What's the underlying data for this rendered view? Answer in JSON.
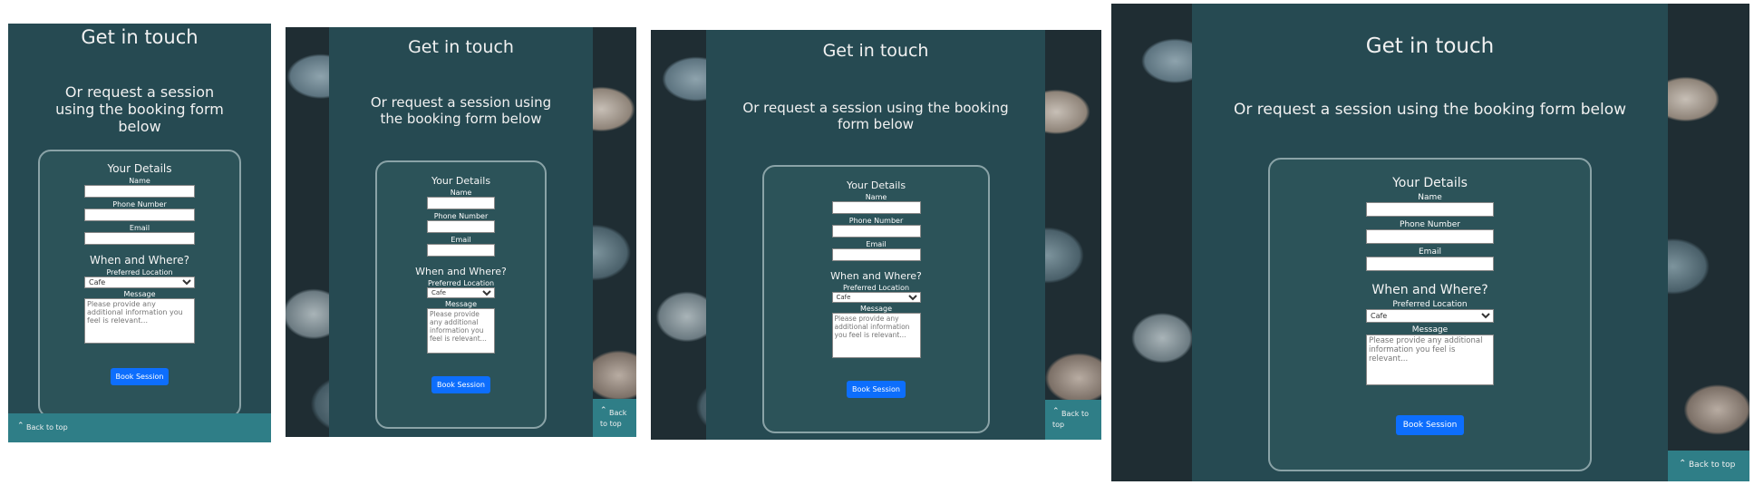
{
  "heading": "Get in touch",
  "subheading": "Or request a session using the booking form below",
  "form": {
    "details_title": "Your Details",
    "name_label": "Name",
    "phone_label": "Phone Number",
    "email_label": "Email",
    "when_title": "When and Where?",
    "location_label": "Preferred Location",
    "location_selected": "Cafe",
    "message_label": "Message",
    "message_placeholder": "Please provide any additional information you feel is relevant...",
    "submit_label": "Book Session"
  },
  "back_to_top": "Back to top",
  "icons": {
    "back_to_top": "chevron-up-icon"
  },
  "colors": {
    "panel": "#264a52",
    "button": "#0d6efd",
    "top_link": "#2f7e87"
  }
}
